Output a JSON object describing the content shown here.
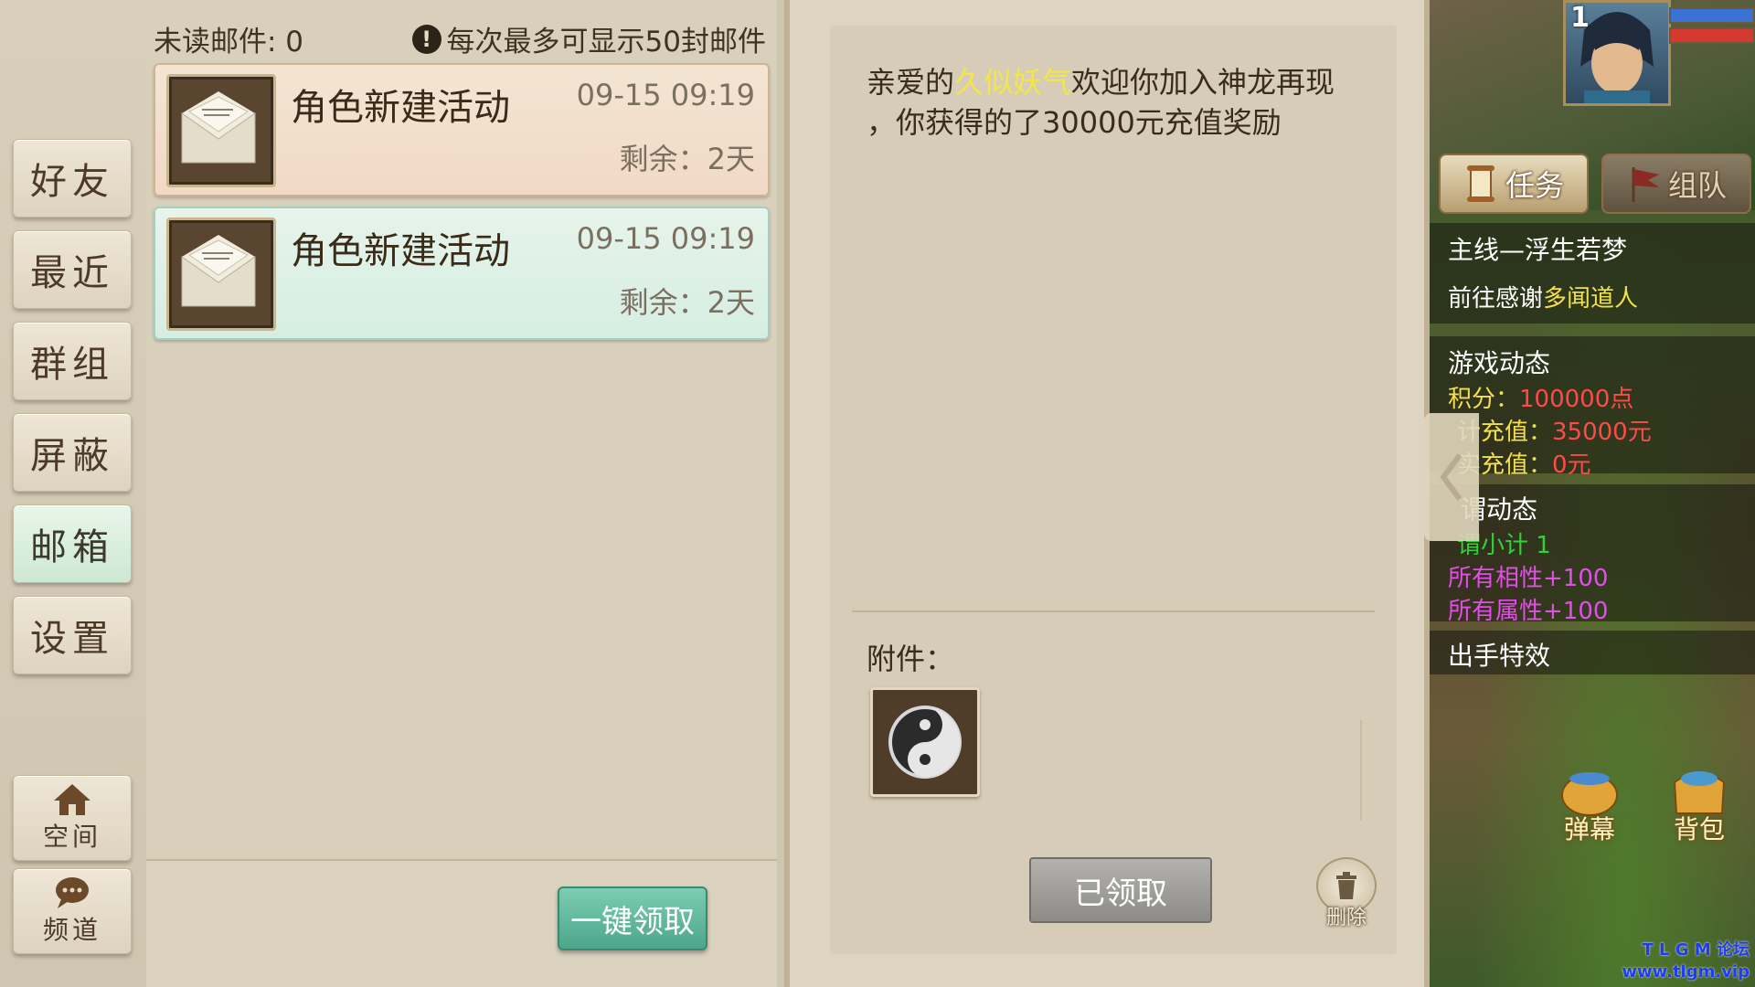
{
  "nav": {
    "items": [
      "好友",
      "最近",
      "群组",
      "屏蔽",
      "邮箱",
      "设置"
    ],
    "space_label": "空间",
    "channel_label": "频道"
  },
  "mail_list": {
    "unread_text": "未读邮件: 0",
    "notice_text": "每次最多可显示50封邮件",
    "items": [
      {
        "title": "角色新建活动",
        "time": "09-15 09:19",
        "remaining": "剩余：2天"
      },
      {
        "title": "角色新建活动",
        "time": "09-15 09:19",
        "remaining": "剩余：2天"
      }
    ],
    "claim_all_label": "一键领取"
  },
  "mail_detail": {
    "greeting": "亲爱的",
    "player_name": "久似妖气",
    "body_1": "欢迎你加入神龙再现",
    "body_2": "，你获得的了30000元充值奖励",
    "attachment_label": "附件：",
    "attachment_icon": "yin-yang-icon",
    "claimed_label": "已领取",
    "delete_label": "删除"
  },
  "game_hud": {
    "level": "1",
    "tab_task": "任务",
    "tab_team": "组队",
    "quest_title": "主线—浮生若梦",
    "quest_desc_prefix": "前往感谢",
    "quest_npc": "多闻道人",
    "dynamic_title": "游戏动态",
    "points_label": "积分：",
    "points_value": "100000点",
    "total_recharge_label": "计充值：",
    "total_recharge_value": "35000元",
    "real_recharge_label": "实充值：",
    "real_recharge_value": "0元",
    "title2": "谓动态",
    "sub2": "谓小计 1",
    "affinity": "所有相性+100",
    "attribute": "所有属性+100",
    "effects": "出手特效",
    "btn_danmu": "弹幕",
    "btn_bag": "背包",
    "watermark_1": "T L G M 论坛",
    "watermark_2": "www.tlgm.vip"
  },
  "colors": {
    "player_name": "#f3e64a",
    "npc_name": "#f4e04a",
    "value_red": "#ff4a4a",
    "value_green": "#2fd23a",
    "bonus_magenta": "#e04fe6",
    "claim_all_button": "#5db597",
    "active_nav": "#d6ecd9"
  }
}
